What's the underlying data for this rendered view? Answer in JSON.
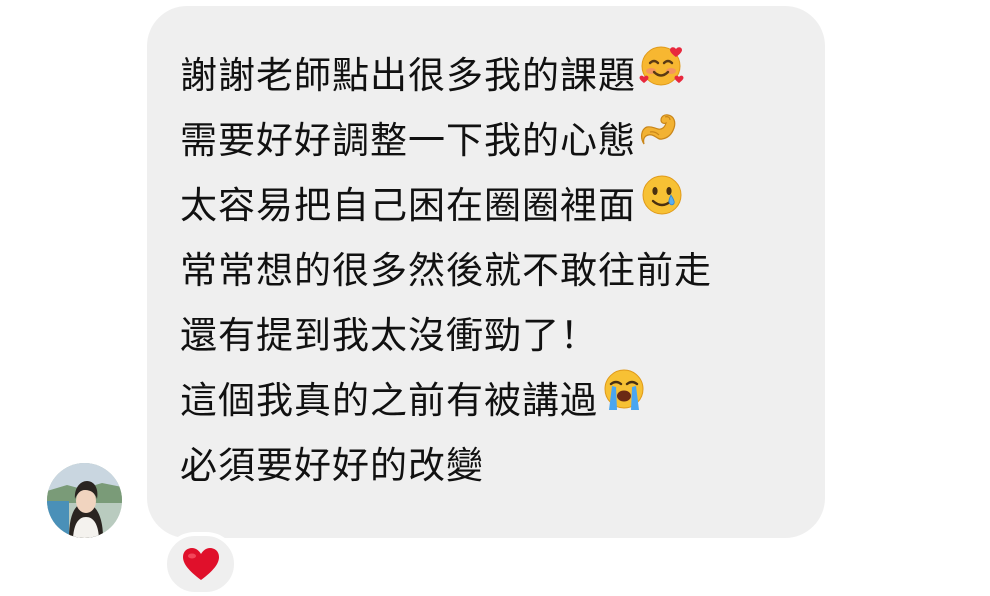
{
  "message": {
    "lines": [
      {
        "text": "謝謝老師點出很多我的課題",
        "emoji": "smiling-face-with-hearts-icon"
      },
      {
        "text": "需要好好調整一下我的心態",
        "emoji": "flexed-biceps-icon"
      },
      {
        "text": "太容易把自己困在圈圈裡面",
        "emoji": "smiling-face-with-tear-icon"
      },
      {
        "text": "常常想的很多然後就不敢往前走",
        "emoji": ""
      },
      {
        "text": "還有提到我太沒衝勁了！",
        "emoji": ""
      },
      {
        "text": "這個我真的之前有被講過",
        "emoji": "loudly-crying-face-icon"
      },
      {
        "text": "必須要好好的改變",
        "emoji": ""
      }
    ]
  },
  "sender": {
    "avatar": "profile-photo"
  },
  "reaction": {
    "icon": "red-heart-icon",
    "color": "#e0102b"
  },
  "colors": {
    "bubble": "#efefef",
    "text": "#111111",
    "background": "#ffffff"
  }
}
